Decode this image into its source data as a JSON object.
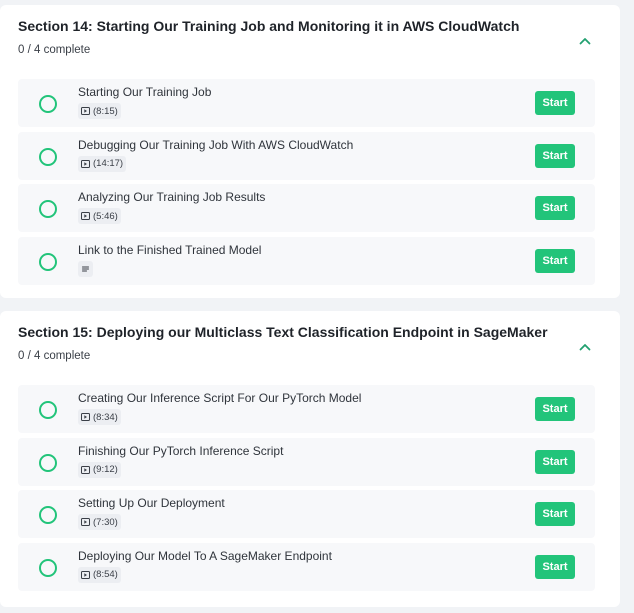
{
  "colors": {
    "accent": "#22c47a",
    "chevron": "#22a070"
  },
  "sections": [
    {
      "title": "Section 14: Starting Our Training Job and Monitoring it in AWS CloudWatch",
      "progress": "0 / 4 complete",
      "collapse_icon": "chevron-up-icon",
      "lessons": [
        {
          "title": "Starting Our Training Job",
          "type": "video",
          "icon": "video-icon",
          "duration": "(8:15)",
          "action": "Start"
        },
        {
          "title": "Debugging Our Training Job With AWS CloudWatch",
          "type": "video",
          "icon": "video-icon",
          "duration": "(14:17)",
          "action": "Start"
        },
        {
          "title": "Analyzing Our Training Job Results",
          "type": "video",
          "icon": "video-icon",
          "duration": "(5:46)",
          "action": "Start"
        },
        {
          "title": "Link to the Finished Trained Model",
          "type": "text",
          "icon": "document-icon",
          "duration": "",
          "action": "Start"
        }
      ]
    },
    {
      "title": "Section 15: Deploying our Multiclass Text Classification Endpoint in SageMaker",
      "progress": "0 / 4 complete",
      "collapse_icon": "chevron-up-icon",
      "lessons": [
        {
          "title": "Creating Our Inference Script For Our PyTorch Model",
          "type": "video",
          "icon": "video-icon",
          "duration": "(8:34)",
          "action": "Start"
        },
        {
          "title": "Finishing Our PyTorch Inference Script",
          "type": "video",
          "icon": "video-icon",
          "duration": "(9:12)",
          "action": "Start"
        },
        {
          "title": "Setting Up Our Deployment",
          "type": "video",
          "icon": "video-icon",
          "duration": "(7:30)",
          "action": "Start"
        },
        {
          "title": "Deploying Our Model To A SageMaker Endpoint",
          "type": "video",
          "icon": "video-icon",
          "duration": "(8:54)",
          "action": "Start"
        }
      ]
    }
  ]
}
